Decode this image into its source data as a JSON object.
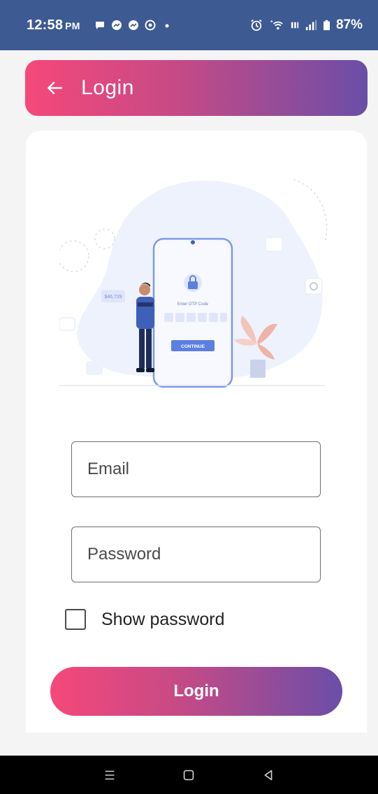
{
  "status_bar": {
    "time": "12:58",
    "ampm": "PM",
    "battery": "87%"
  },
  "app_bar": {
    "title": "Login"
  },
  "illustration": {
    "stat_label": "$46,729",
    "otp_title": "Enter OTP Code",
    "continue_label": "CONTINUE"
  },
  "form": {
    "email_placeholder": "Email",
    "password_placeholder": "Password",
    "show_password_label": "Show password",
    "login_label": "Login"
  },
  "colors": {
    "status_bar": "#3d5a93",
    "gradient_start": "#f5487a",
    "gradient_end": "#6a4ea8",
    "illustration_blob": "#eef2fc",
    "illustration_accent": "#5d7fe0"
  }
}
